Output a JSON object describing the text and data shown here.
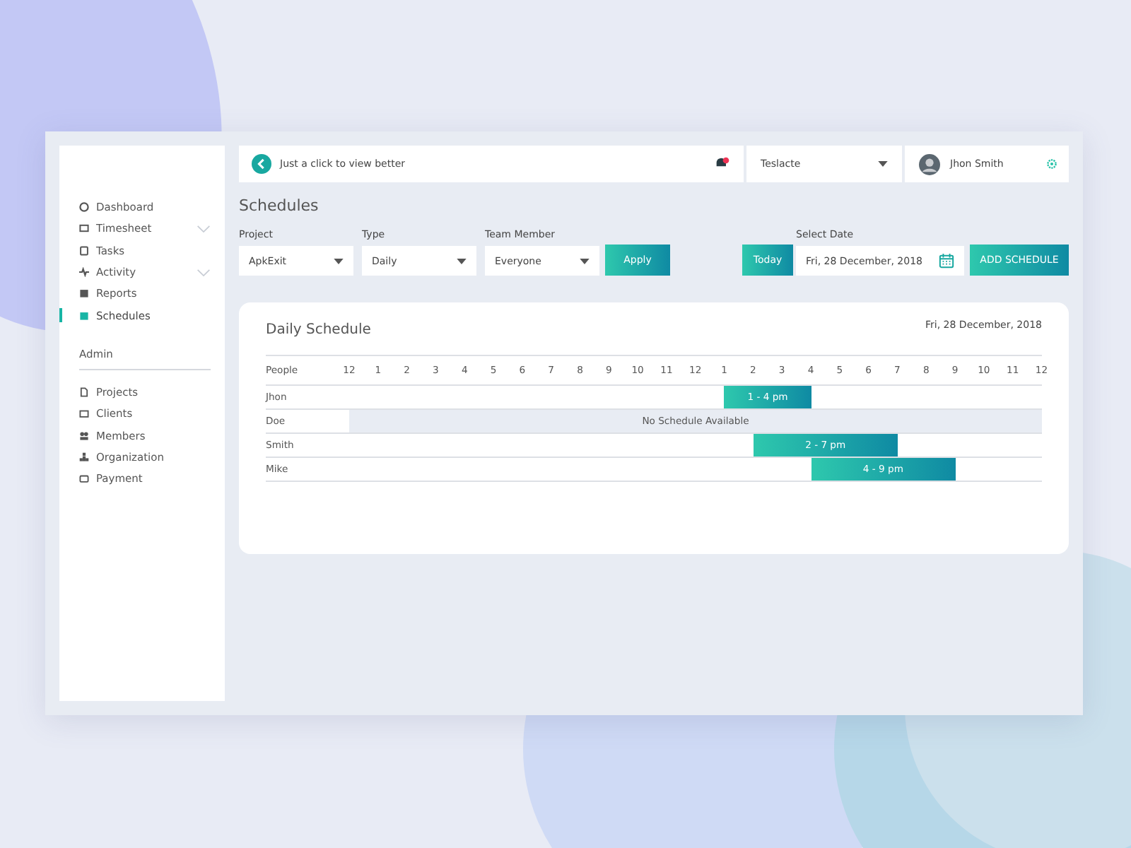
{
  "sidebar": {
    "items": [
      {
        "label": "Dashboard",
        "expandable": false,
        "selected": false
      },
      {
        "label": "Timesheet",
        "expandable": true,
        "selected": false
      },
      {
        "label": "Tasks",
        "expandable": false,
        "selected": false
      },
      {
        "label": "Activity",
        "expandable": true,
        "selected": false
      },
      {
        "label": "Reports",
        "expandable": false,
        "selected": false
      },
      {
        "label": "Schedules",
        "expandable": false,
        "selected": true
      }
    ],
    "section_title": "Admin",
    "admin_items": [
      {
        "label": "Projects",
        "selected": false
      },
      {
        "label": "Clients",
        "selected": false
      },
      {
        "label": "Members",
        "selected": false
      },
      {
        "label": "Organization",
        "selected": false
      },
      {
        "label": "Payment",
        "selected": false
      }
    ]
  },
  "topbar": {
    "hint": "Just a click to view better",
    "organization": "Teslacte",
    "user": "Jhon Smith"
  },
  "page_title": "Schedules",
  "filters": [
    {
      "label": "Project",
      "value": "ApkExit"
    },
    {
      "label": "Type",
      "value": "Daily"
    },
    {
      "label": "Team Member",
      "value": "Everyone"
    }
  ],
  "apply_button": "Apply",
  "today_button": "Today",
  "date_field": {
    "label": "Select Date",
    "value": "Fri, 28 December, 2018"
  },
  "add_button": "ADD SCHEDULE",
  "schedule": {
    "title": "Daily Schedule",
    "date": "Fri, 28 December, 2018",
    "people_header": "People",
    "hours": [
      "12",
      "1",
      "2",
      "3",
      "4",
      "5",
      "6",
      "7",
      "8",
      "9",
      "10",
      "11",
      "12",
      "1",
      "2",
      "3",
      "4",
      "5",
      "6",
      "7",
      "8",
      "9",
      "10",
      "11",
      "12"
    ],
    "rows": [
      {
        "name": "Jhon",
        "kind": "slot",
        "label": "1 - 4 pm"
      },
      {
        "name": "Doe",
        "kind": "empty",
        "label": "No Schedule Available"
      },
      {
        "name": "Smith",
        "kind": "slot",
        "label": "2 - 7 pm"
      },
      {
        "name": "Mike",
        "kind": "slot",
        "label": "4 - 9 pm"
      }
    ]
  }
}
